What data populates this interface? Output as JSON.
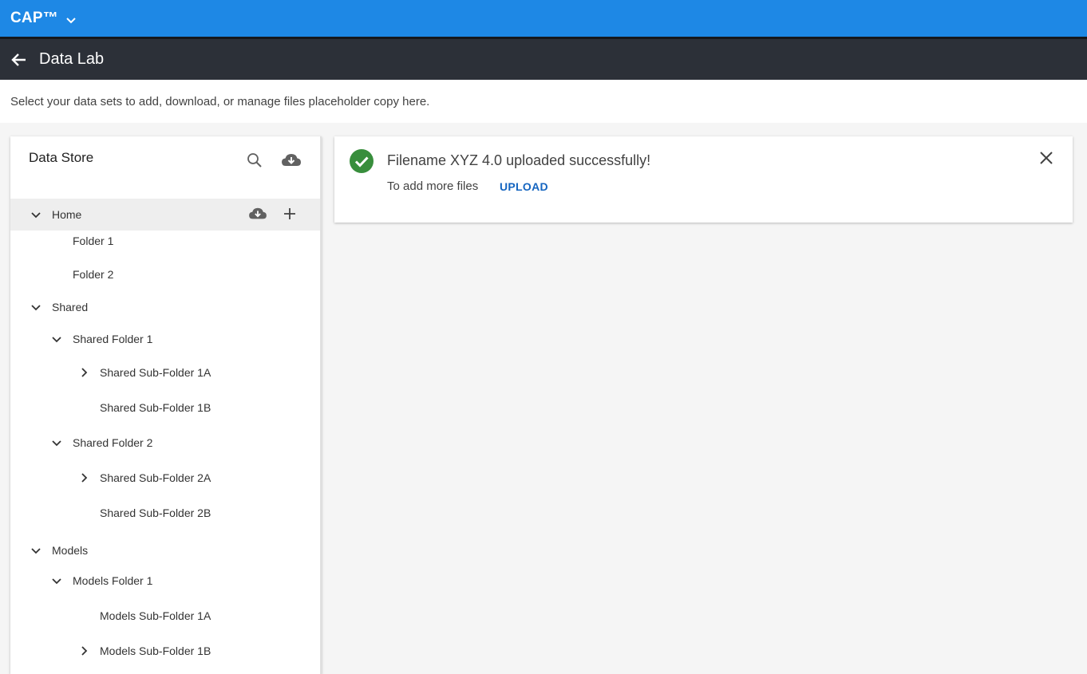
{
  "app": {
    "brand": "CAP™",
    "brand_menu_icon": "chevron-down-icon"
  },
  "header": {
    "back_icon": "arrow-left-icon",
    "title": "Data Lab"
  },
  "description": "Select your data sets to add, download, or manage files placeholder copy here.",
  "data_store": {
    "title": "Data Store",
    "actions": [
      "search-icon",
      "cloud-download-icon"
    ],
    "tree": [
      {
        "label": "Home",
        "level": 0,
        "state": "expanded",
        "selected": true,
        "actions": [
          "cloud-download-icon",
          "plus-icon"
        ]
      },
      {
        "label": "Folder 1",
        "level": 1,
        "state": "leaf"
      },
      {
        "label": "Folder 2",
        "level": 1,
        "state": "leaf"
      },
      {
        "label": "Shared",
        "level": 0,
        "state": "expanded"
      },
      {
        "label": "Shared Folder 1",
        "level": 1,
        "state": "expanded"
      },
      {
        "label": "Shared Sub-Folder 1A",
        "level": 2,
        "state": "collapsed"
      },
      {
        "label": "Shared Sub-Folder 1B",
        "level": 2,
        "state": "leaf"
      },
      {
        "label": "Shared Folder 2",
        "level": 1,
        "state": "expanded"
      },
      {
        "label": "Shared Sub-Folder 2A",
        "level": 2,
        "state": "collapsed"
      },
      {
        "label": "Shared Sub-Folder 2B",
        "level": 2,
        "state": "leaf"
      },
      {
        "label": "Models",
        "level": 0,
        "state": "expanded"
      },
      {
        "label": "Models Folder 1",
        "level": 1,
        "state": "expanded"
      },
      {
        "label": "Models Sub-Folder 1A",
        "level": 2,
        "state": "leaf"
      },
      {
        "label": "Models Sub-Folder 1B",
        "level": 2,
        "state": "collapsed"
      }
    ]
  },
  "notification": {
    "status_icon": "check-circle-icon",
    "message": "Filename XYZ 4.0 uploaded successfully!",
    "sub_text": "To add more files",
    "action_label": "UPLOAD",
    "close_icon": "close-icon"
  },
  "colors": {
    "top_bar": "#1e88e5",
    "sub_bar": "#2c3038",
    "success": "#388e3c",
    "link": "#1565c0",
    "selected_row": "#eeeeee"
  }
}
